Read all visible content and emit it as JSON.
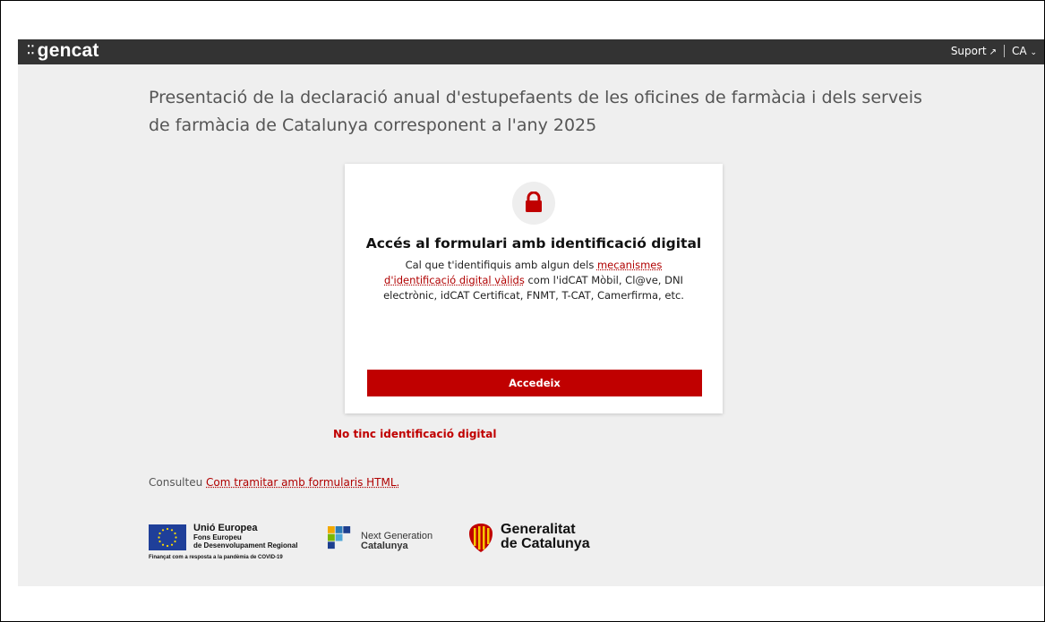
{
  "header": {
    "logo_text": "gencat",
    "support_label": "Suport",
    "language_label": "CA"
  },
  "page": {
    "title": "Presentació de la declaració anual d'estupefaents de les oficines de farmàcia i dels serveis de farmàcia de Catalunya corresponent a l'any 2025"
  },
  "card": {
    "title": "Accés al formulari amb identificació digital",
    "text_before": "Cal que t'identifiquis amb algun dels ",
    "link_label": "mecanismes d'identificació digital vàlids",
    "text_after": " com l'idCAT Mòbil, Cl@ve, DNI electrònic, idCAT Certificat, FNMT, T-CAT, Camerfirma, etc.",
    "button_label": "Accedeix"
  },
  "no_id_link": "No tinc identificació digital",
  "consult": {
    "prefix": "Consulteu ",
    "link_label": "Com tramitar amb formularis HTML."
  },
  "logos": {
    "eu_line1": "Unió Europea",
    "eu_line2": "Fons Europeu",
    "eu_line3": "de Desenvolupament Regional",
    "eu_caption": "Finançat com a resposta a la pandèmia de COVID-19",
    "ngc_line1": "Next Generation",
    "ngc_line2": "Catalunya",
    "gen_line1": "Generalitat",
    "gen_line2": "de Catalunya"
  },
  "colors": {
    "accent_red": "#c00000",
    "topbar": "#333333",
    "background": "#efefef"
  }
}
